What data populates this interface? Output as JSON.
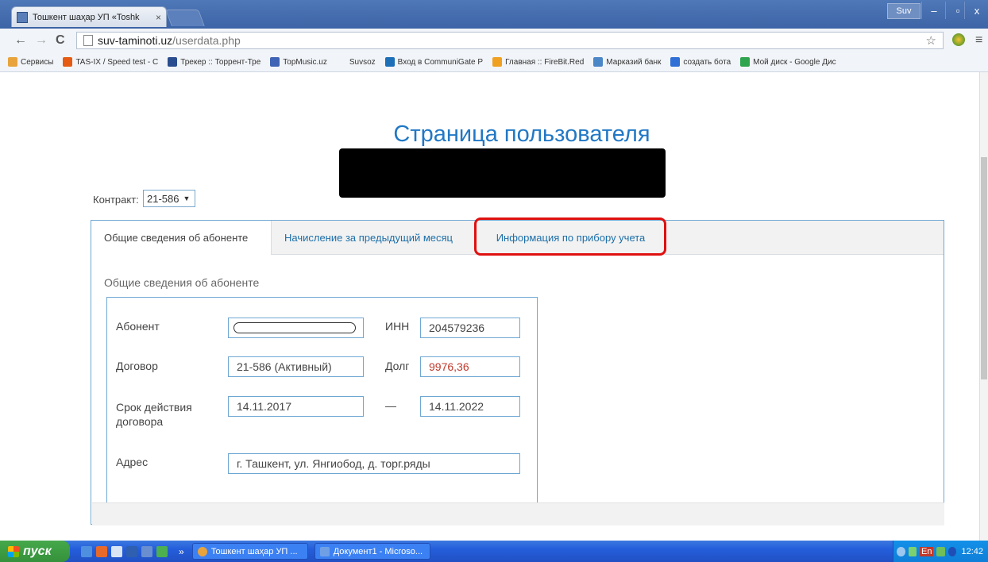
{
  "browser": {
    "tab_title": "Тошкент шаҳар УП «Toshk",
    "tab_close": "×",
    "user_chip": "Suv",
    "window_controls": [
      "–",
      "▫",
      "x"
    ],
    "nav": {
      "back": "←",
      "forward": "→",
      "reload": "C"
    },
    "url_host": "suv-taminoti.uz",
    "url_path": "/userdata.php",
    "star": "☆",
    "menu": "≡"
  },
  "bookmarks": [
    {
      "label": "Сервисы",
      "color": "#e8a33d"
    },
    {
      "label": "TAS-IX / Speed test - C",
      "color": "#e55b13"
    },
    {
      "label": "Трекер :: Торрент-Тре",
      "color": "#2a4d8f"
    },
    {
      "label": "TopMusic.uz",
      "color": "#3f63b5"
    },
    {
      "label": "Suvsoz",
      "color": "#f1f4f8"
    },
    {
      "label": "Вход в CommuniGate P",
      "color": "#1d6fb8"
    },
    {
      "label": "Главная :: FireBit.Red",
      "color": "#f0a020"
    },
    {
      "label": "Марказий банк",
      "color": "#4b86c6"
    },
    {
      "label": "создать бота",
      "color": "#2f6fd6"
    },
    {
      "label": "Мой диск - Google Дис",
      "color": "#2ea44f"
    }
  ],
  "page": {
    "title": "Страница пользователя",
    "contract_label": "Контракт:",
    "contract_value": "21-586",
    "select_arrow": "▼",
    "tabs": [
      {
        "label": "Общие сведения об абоненте"
      },
      {
        "label": "Начисление за предыдущий месяц"
      },
      {
        "label": "Информация по прибору учета"
      }
    ],
    "section_label": "Общие сведения об абоненте",
    "fields": {
      "abonent_label": "Абонент",
      "inn_label": "ИНН",
      "inn_value": "204579236",
      "dogovor_label": "Договор",
      "dogovor_value": "21-586 (Активный)",
      "debt_label": "Долг",
      "debt_value": "9976,36",
      "term_label_1": "Срок действия",
      "term_label_2": "договора",
      "term_start": "14.11.2017",
      "term_dash": "—",
      "term_end": "14.11.2022",
      "address_label": "Адрес",
      "address_value": "г. Ташкент, ул. Янгиобод, д. торг.ряды"
    }
  },
  "taskbar": {
    "start_label": "пуск",
    "chevron": "»",
    "tasks": [
      {
        "label": "Тошкент шаҳар УП ...",
        "color": "#e8a33d"
      },
      {
        "label": "Документ1 - Microso...",
        "color": "#6fa0e6"
      }
    ],
    "tray_lang": "En",
    "clock": "12:42"
  }
}
